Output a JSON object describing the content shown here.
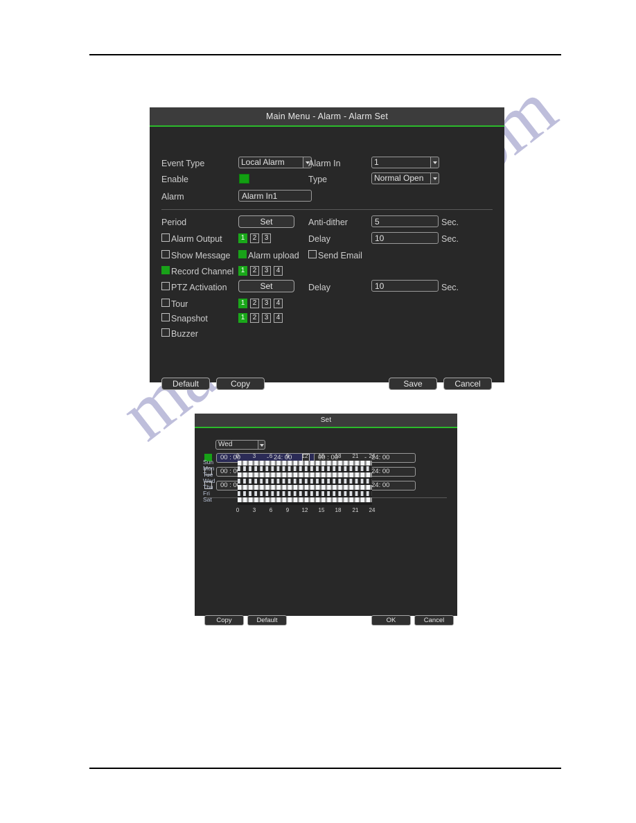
{
  "watermark": {
    "text": "manualshive.com"
  },
  "alarm_set_dialog": {
    "title": "Main Menu - Alarm - Alarm Set",
    "labels": {
      "event_type": "Event Type",
      "alarm_in": "Alarm In",
      "enable": "Enable",
      "type": "Type",
      "alarm": "Alarm",
      "period": "Period",
      "anti_dither": "Anti-dither",
      "alarm_output": "Alarm Output",
      "delay": "Delay",
      "show_message": "Show Message",
      "alarm_upload": "Alarm upload",
      "send_email": "Send Email",
      "record_channel": "Record Channel",
      "ptz_activation": "PTZ Activation",
      "tour": "Tour",
      "snapshot": "Snapshot",
      "buzzer": "Buzzer",
      "sec": "Sec."
    },
    "values": {
      "event_type": "Local Alarm",
      "alarm_in": "1",
      "type": "Normal Open",
      "alarm_name": "Alarm In1",
      "anti_dither": "5",
      "alarm_output_delay": "10",
      "ptz_delay": "10"
    },
    "buttons": {
      "period_set": "Set",
      "ptz_set": "Set",
      "default": "Default",
      "copy": "Copy",
      "save": "Save",
      "cancel": "Cancel"
    },
    "checkboxes": {
      "enable": true,
      "alarm_output": false,
      "show_message": false,
      "alarm_upload": true,
      "send_email": false,
      "record_channel": true,
      "ptz_activation": false,
      "tour": false,
      "snapshot": false,
      "buzzer": false
    },
    "channel_groups": {
      "alarm_output": {
        "items": [
          "1",
          "2",
          "3"
        ],
        "selected": [
          "1"
        ]
      },
      "record_channel": {
        "items": [
          "1",
          "2",
          "3",
          "4"
        ],
        "selected": [
          "1"
        ]
      },
      "tour": {
        "items": [
          "1",
          "2",
          "3",
          "4"
        ],
        "selected": [
          "1"
        ]
      },
      "snapshot": {
        "items": [
          "1",
          "2",
          "3",
          "4"
        ],
        "selected": [
          "1"
        ]
      }
    }
  },
  "period_set_dialog": {
    "title": "Set",
    "day_selected": "Wed",
    "periods": [
      {
        "enabled": true,
        "start": "00 : 00",
        "dash": "-",
        "end": "24: 00",
        "highlighted": true
      },
      {
        "enabled": false,
        "start": "00 : 00",
        "dash": "-",
        "end": "24: 00",
        "highlighted": false
      },
      {
        "enabled": false,
        "start": "00 : 00",
        "dash": "-",
        "end": "24: 00",
        "highlighted": false
      },
      {
        "enabled": false,
        "start": "00 : 00",
        "dash": "-",
        "end": "24: 00",
        "highlighted": false
      },
      {
        "enabled": false,
        "start": "00 : 00",
        "dash": "-",
        "end": "24: 00",
        "highlighted": false
      },
      {
        "enabled": false,
        "start": "00 : 00",
        "dash": "-",
        "end": "24: 00",
        "highlighted": false
      }
    ],
    "schedule": {
      "days": [
        "Sun",
        "Mon",
        "Tue",
        "Wed",
        "Thu",
        "Fri",
        "Sat"
      ],
      "hour_ticks": [
        "0",
        "3",
        "6",
        "9",
        "12",
        "15",
        "18",
        "21",
        "24"
      ]
    },
    "buttons": {
      "copy": "Copy",
      "default": "Default",
      "ok": "OK",
      "cancel": "Cancel"
    }
  }
}
